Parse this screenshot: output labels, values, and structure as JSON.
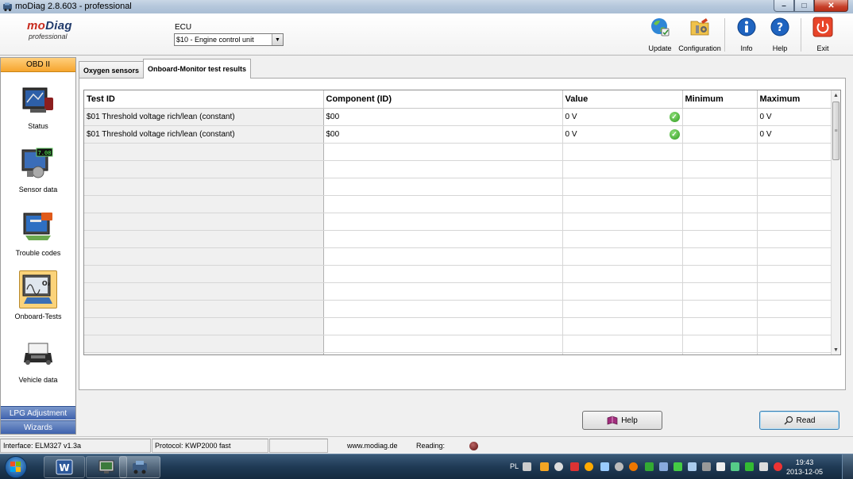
{
  "window": {
    "title": "moDiag 2.8.603 - professional",
    "min_symbol": "–",
    "max_symbol": "□",
    "close_symbol": "✕"
  },
  "logo": {
    "mo": "mo",
    "diag": "Diag",
    "edition": "professional"
  },
  "ecu": {
    "label": "ECU",
    "value": "$10 - Engine control unit"
  },
  "toolbar": {
    "update": "Update",
    "configuration": "Configuration",
    "info": "Info",
    "help": "Help",
    "exit": "Exit"
  },
  "sidebar": {
    "header": "OBD II",
    "items": [
      {
        "label": "Status",
        "icon": "status-icon"
      },
      {
        "label": "Sensor data",
        "icon": "sensor-data-icon"
      },
      {
        "label": "Trouble codes",
        "icon": "trouble-codes-icon"
      },
      {
        "label": "Onboard-Tests",
        "icon": "onboard-tests-icon",
        "active": true
      },
      {
        "label": "Vehicle data",
        "icon": "vehicle-data-icon"
      }
    ],
    "tabs": [
      "LPG Adjustment",
      "Wizards"
    ]
  },
  "tabs": [
    {
      "label": "Oxygen sensors",
      "active": false
    },
    {
      "label": "Onboard-Monitor test results",
      "active": true
    }
  ],
  "table": {
    "columns": [
      "Test ID",
      "Component (ID)",
      "Value",
      "Minimum",
      "Maximum"
    ],
    "rows": [
      {
        "test_id": "$01 Threshold voltage rich/lean (constant)",
        "component": "$00",
        "value": "0 V",
        "ok": true,
        "minimum": "",
        "maximum": "0 V"
      },
      {
        "test_id": "$01 Threshold voltage rich/lean (constant)",
        "component": "$00",
        "value": "0 V",
        "ok": true,
        "minimum": "",
        "maximum": "0 V"
      }
    ],
    "empty_rows": 13,
    "ok_symbol": "✓"
  },
  "buttons": {
    "help": "Help",
    "read": "Read"
  },
  "statusbar": {
    "interface": "Interface: ELM327 v1.3a",
    "protocol": "Protocol: KWP2000 fast",
    "website": "www.modiag.de",
    "reading_label": "Reading:"
  },
  "taskbar": {
    "lang": "PL",
    "time": "19:43",
    "date": "2013-12-05",
    "word_letter": "W"
  },
  "colors": {
    "accent_orange": "#f6a52e",
    "sidebar_tab_blue": "#3f62ad",
    "ok_green": "#2f9a1f",
    "brand_red": "#c82c1f",
    "brand_navy": "#203a6b"
  }
}
